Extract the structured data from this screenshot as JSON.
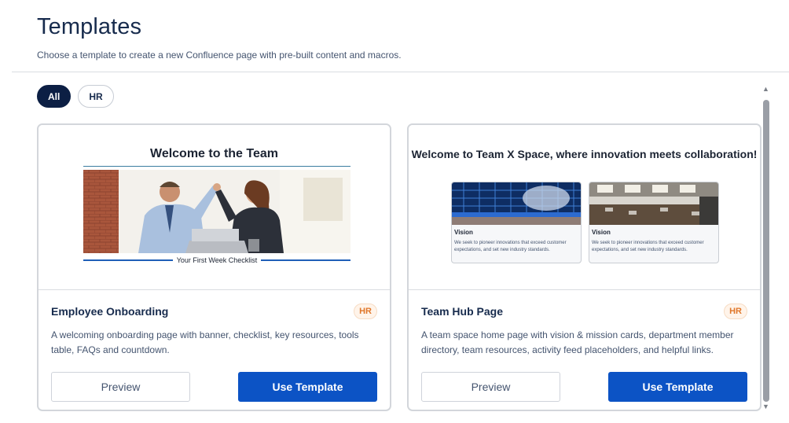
{
  "page": {
    "title": "Templates",
    "subtitle": "Choose a template to create a new Confluence page with pre-built content and macros."
  },
  "filters": [
    {
      "label": "All",
      "active": true
    },
    {
      "label": "HR",
      "active": false
    }
  ],
  "cards": [
    {
      "title": "Employee Onboarding",
      "badge": "HR",
      "description": "A welcoming onboarding page with banner, checklist, key resources, tools table, FAQs and countdown.",
      "preview_label": "Preview",
      "use_label": "Use Template",
      "thumbnail": {
        "heading": "Welcome to the Team",
        "caption": "Your First Week Checklist"
      }
    },
    {
      "title": "Team Hub Page",
      "badge": "HR",
      "description": "A team space home page with vision & mission cards, department member directory, team resources, activity feed placeholders, and helpful links.",
      "preview_label": "Preview",
      "use_label": "Use Template",
      "thumbnail": {
        "heading": "Welcome to Team X Space, where innovation meets collaboration!",
        "mini_cards": [
          {
            "label": "Vision",
            "text": "We seek to pioneer innovations that exceed customer expectations, and set new industry standards."
          },
          {
            "label": "Vision",
            "text": "We seek to pioneer innovations that exceed customer expectations, and set new industry standards."
          }
        ]
      }
    }
  ],
  "colors": {
    "primary_button": "#0c53c5",
    "active_chip": "#0c1f44",
    "badge_text": "#e0772b"
  },
  "icons": {
    "scroll_up": "triangle-up-icon",
    "scroll_down": "triangle-down-icon"
  }
}
